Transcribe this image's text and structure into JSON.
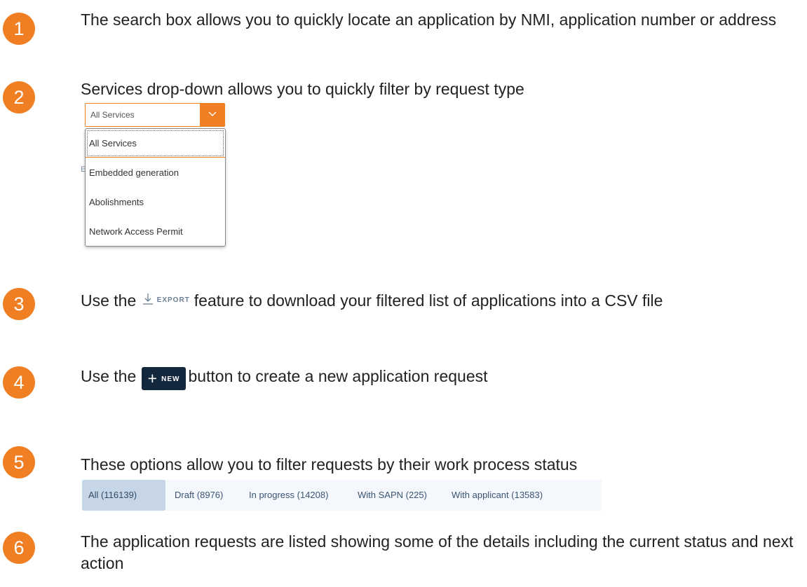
{
  "colors": {
    "accent": "#f07f23",
    "dark_button": "#13283d",
    "tab_active_bg": "#c6d6e6",
    "tab_strip_bg": "#f4f7fb",
    "tab_text": "#3a5674"
  },
  "steps": [
    {
      "number": "1",
      "text": "The search box allows you to quickly locate an application by NMI, application number or address"
    },
    {
      "number": "2",
      "text": "Services drop-down allows you to quickly filter by request type"
    },
    {
      "number": "3",
      "text_before": "Use the",
      "text_after": "feature to download your filtered list of applications into a CSV file"
    },
    {
      "number": "4",
      "text_before": "Use the",
      "text_after": "button to create a new application request"
    },
    {
      "number": "5",
      "text": "These options allow you to filter requests by their work process status"
    },
    {
      "number": "6",
      "text": "The application requests are listed showing some of the details including the current status and next action"
    }
  ],
  "services_dropdown": {
    "selected_value": "All Services",
    "icon": "chevron-down-icon",
    "options": [
      "All Services",
      "Embedded generation",
      "Abolishments",
      "Network Access Permit"
    ],
    "behind_fragment": "E"
  },
  "export_button": {
    "label": "EXPORT",
    "icon": "download-icon"
  },
  "new_button": {
    "label": "NEW",
    "icon": "plus-icon"
  },
  "status_tabs": [
    {
      "label": "All (116139)",
      "active": true
    },
    {
      "label": "Draft (8976)",
      "active": false
    },
    {
      "label": "In progress (14208)",
      "active": false
    },
    {
      "label": "With SAPN (225)",
      "active": false
    },
    {
      "label": "With applicant (13583)",
      "active": false
    }
  ]
}
